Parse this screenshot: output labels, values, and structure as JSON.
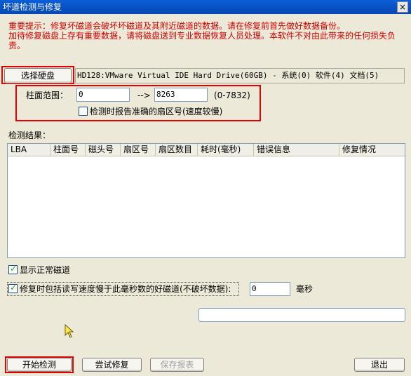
{
  "window": {
    "title": "坏道检测与修复",
    "close_label": "×"
  },
  "warning": {
    "line1": "重要提示：修复坏磁道会破坏坏磁道及其附近磁道的数据。请在修复前首先做好数据备份。",
    "line2": "加待修复磁盘上存有重要数据，请将磁盘送到专业数据恢复人员处理。本软件不对由此带来的任何损失负责。"
  },
  "disk": {
    "select_label": "选择硬盘",
    "info": "HD128:VMware Virtual IDE Hard Drive(60GB) - 系统(0) 软件(4) 文档(5)"
  },
  "range": {
    "label": "柱面范围：",
    "start": "0",
    "arrow": "-->",
    "end": "8263",
    "hint": "(0-7832)",
    "report_label": "检测时报告准确的扇区号(速度较慢)"
  },
  "results": {
    "title": "检测结果：",
    "columns": [
      "LBA",
      "柱面号",
      "磁头号",
      "扇区号",
      "扇区数目",
      "耗时(毫秒)",
      "错误信息",
      "修复情况"
    ]
  },
  "options": {
    "show_normal_label": "显示正常磁道",
    "include_slow_label": "修复时包括读写速度慢于此毫秒数的好磁道(不破坏数据):",
    "slow_ms": "0",
    "unit": "毫秒"
  },
  "actions": {
    "start": "开始检测",
    "try_repair": "尝试修复",
    "save_report": "保存报表",
    "exit": "退出"
  }
}
